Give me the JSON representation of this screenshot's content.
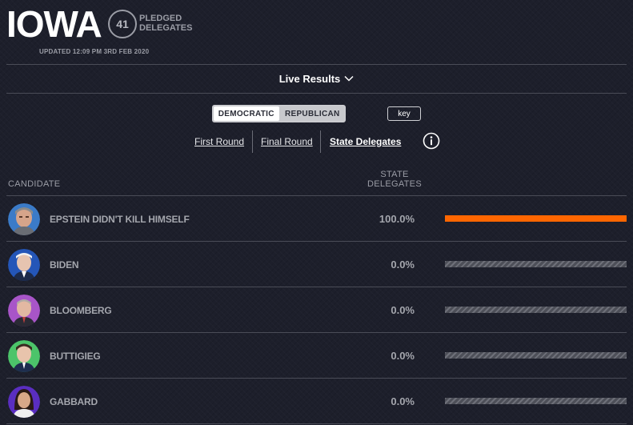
{
  "header": {
    "state": "IOWA",
    "pledged_count": "41",
    "pledged_label_1": "PLEDGED",
    "pledged_label_2": "DELEGATES",
    "updated": "UPDATED 12:09 PM 3RD FEB 2020"
  },
  "live": {
    "label": "Live Results",
    "icon": "chevron-down-icon"
  },
  "party_toggle": {
    "options": [
      "DEMOCRATIC",
      "REPUBLICAN"
    ],
    "selected": "DEMOCRATIC"
  },
  "key_label": "key",
  "rounds": {
    "tabs": [
      "First Round",
      "Final Round",
      "State Delegates"
    ],
    "active": "State Delegates",
    "info_icon": "info-icon"
  },
  "table": {
    "col_candidate": "CANDIDATE",
    "col_state_1": "STATE",
    "col_state_2": "DELEGATES",
    "rows": [
      {
        "name": "EPSTEIN DIDN'T KILL HIMSELF",
        "pct": "100.0%",
        "share": 1.0,
        "avatar_bg": "#3b7bc8"
      },
      {
        "name": "BIDEN",
        "pct": "0.0%",
        "share": 0.0,
        "avatar_bg": "#2456b8"
      },
      {
        "name": "BLOOMBERG",
        "pct": "0.0%",
        "share": 0.0,
        "avatar_bg": "#a855c8"
      },
      {
        "name": "BUTTIGIEG",
        "pct": "0.0%",
        "share": 0.0,
        "avatar_bg": "#4cc46a"
      },
      {
        "name": "GABBARD",
        "pct": "0.0%",
        "share": 0.0,
        "avatar_bg": "#5a2ec0"
      }
    ]
  },
  "colors": {
    "accent": "#ff6600",
    "background": "#1d1f2b",
    "muted_text": "#a4a6ad"
  }
}
